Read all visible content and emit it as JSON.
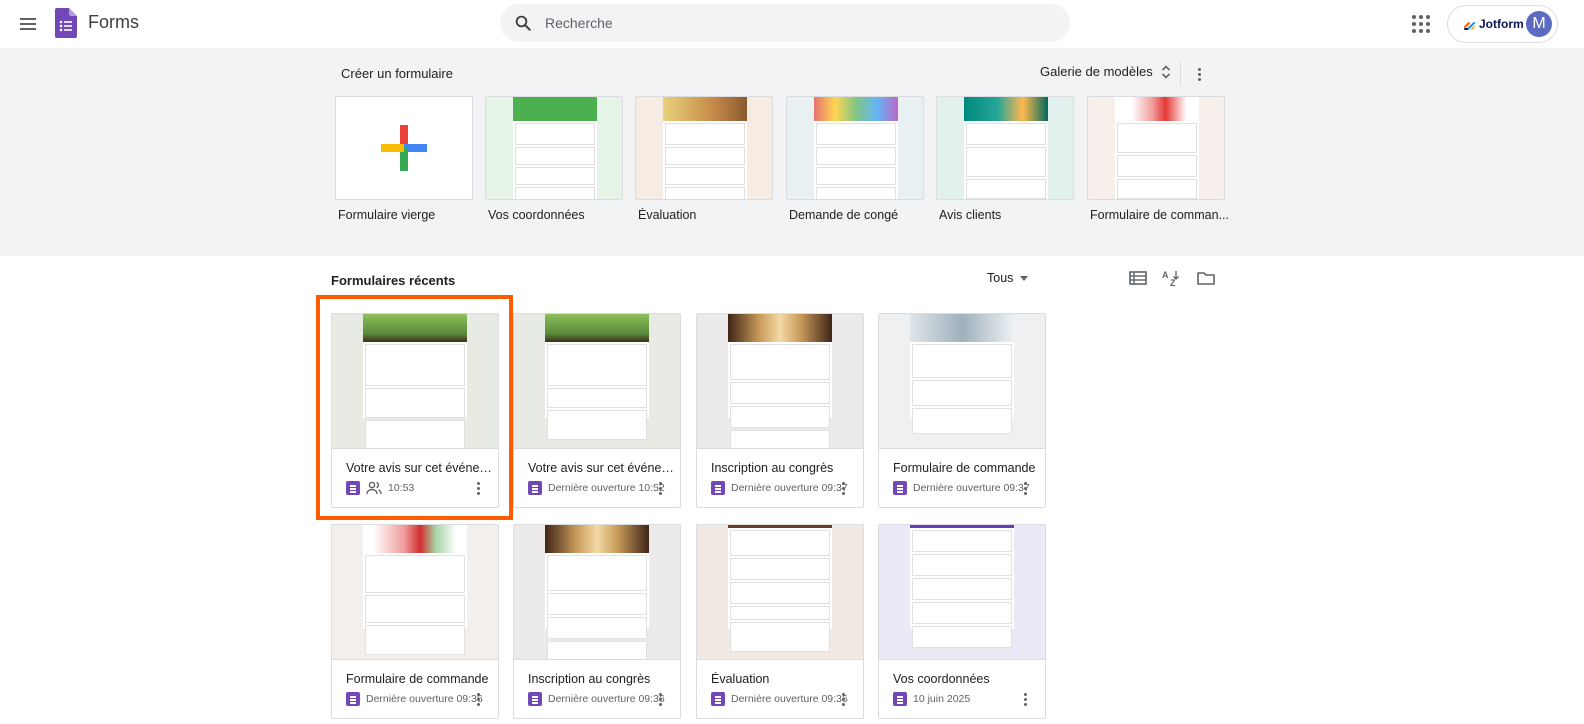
{
  "app": {
    "title": "Forms"
  },
  "search": {
    "placeholder": "Recherche"
  },
  "account": {
    "brand": "Jotform",
    "avatar_initial": "M"
  },
  "templates_section": {
    "create_label": "Créer un formulaire",
    "gallery_label": "Galerie de modèles",
    "items": [
      {
        "name": "Formulaire vierge"
      },
      {
        "name": "Vos coordonnées"
      },
      {
        "name": "Évaluation"
      },
      {
        "name": "Demande de congé"
      },
      {
        "name": "Avis clients"
      },
      {
        "name": "Formulaire de comman..."
      }
    ]
  },
  "recent_section": {
    "label": "Formulaires récents",
    "owner_filter": "Tous",
    "forms": [
      {
        "title": "Votre avis sur cet événem...",
        "meta": "10:53",
        "shared": true
      },
      {
        "title": "Votre avis sur cet événem...",
        "meta": "Dernière ouverture 10:52",
        "shared": false
      },
      {
        "title": "Inscription au congrès",
        "meta": "Dernière ouverture 09:37",
        "shared": false
      },
      {
        "title": "Formulaire de commande",
        "meta": "Dernière ouverture 09:37",
        "shared": false
      },
      {
        "title": "Formulaire de commande",
        "meta": "Dernière ouverture 09:36",
        "shared": false
      },
      {
        "title": "Inscription au congrès",
        "meta": "Dernière ouverture 09:36",
        "shared": false
      },
      {
        "title": "Évaluation",
        "meta": "Dernière ouverture 09:36",
        "shared": false
      },
      {
        "title": "Vos coordonnées",
        "meta": "10 juin 2025",
        "shared": false
      }
    ]
  },
  "colors": {
    "brand_purple": "#7248b9",
    "highlight": "#ff5b00",
    "section_bg": "#f1f3f4"
  }
}
